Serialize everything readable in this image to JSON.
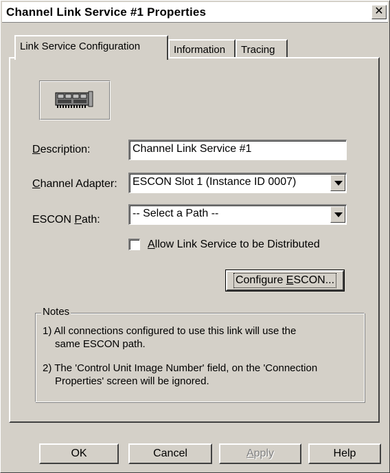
{
  "window": {
    "title": "Channel Link Service #1 Properties",
    "close_label": "✕"
  },
  "tabs": [
    {
      "label": "Link Service Configuration",
      "active": true
    },
    {
      "label": "Information",
      "active": false
    },
    {
      "label": "Tracing",
      "active": false
    }
  ],
  "form": {
    "description_label_mnemonic": "D",
    "description_label_rest": "escription:",
    "description_value": "Channel Link Service #1",
    "adapter_label_mnemonic": "C",
    "adapter_label_rest": "hannel Adapter:",
    "adapter_value": "ESCON Slot 1 (Instance ID 0007)",
    "path_label_pre": "ESCON ",
    "path_label_mnemonic": "P",
    "path_label_rest": "ath:",
    "path_value": "-- Select a Path --",
    "distribute_label_mnemonic": "A",
    "distribute_label_rest": "llow Link Service to be Distributed",
    "distribute_checked": false,
    "configure_label_pre": "Configure ",
    "configure_label_mnemonic": "E",
    "configure_label_rest": "SCON..."
  },
  "notes": {
    "legend": "Notes",
    "note1_line1": "1) All connections configured to use this link will use the",
    "note1_line2": "same ESCON path.",
    "note2_line1": "2) The 'Control Unit Image Number' field, on the 'Connection",
    "note2_line2": "Properties' screen will be ignored."
  },
  "buttons": {
    "ok": "OK",
    "cancel": "Cancel",
    "apply_mnemonic": "A",
    "apply_rest": "pply",
    "help": "Help"
  },
  "icons": {
    "adapter_card": "network-adapter-card-icon"
  }
}
